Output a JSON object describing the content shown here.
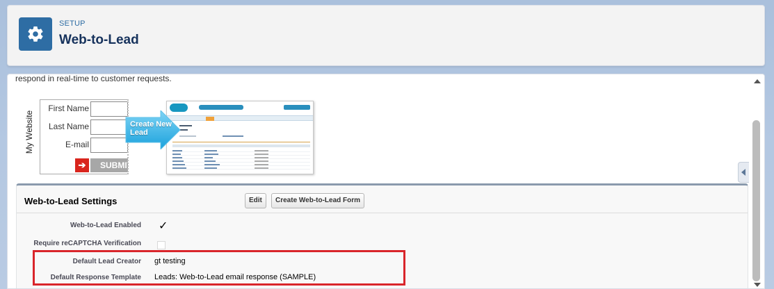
{
  "header": {
    "eyebrow": "SETUP",
    "title": "Web-to-Lead",
    "icon": "gear-icon",
    "icon_bg": "#2e6da4"
  },
  "intro": {
    "text": "respond in real-time to customer requests."
  },
  "illustration": {
    "website_label": "My Website",
    "fields": [
      {
        "label": "First Name"
      },
      {
        "label": "Last Name"
      },
      {
        "label": "E-mail"
      }
    ],
    "submit_label": "SUBMIT",
    "callout": "Create New Lead"
  },
  "settings": {
    "title": "Web-to-Lead Settings",
    "edit_label": "Edit",
    "create_form_label": "Create Web-to-Lead Form",
    "fields": {
      "enabled_label": "Web-to-Lead Enabled",
      "enabled_value": "✓",
      "recaptcha_label": "Require reCAPTCHA Verification",
      "creator_label": "Default Lead Creator",
      "creator_value": "gt testing",
      "template_label": "Default Response Template",
      "template_value": "Leads: Web-to-Lead email response (SAMPLE)"
    }
  },
  "colors": {
    "highlight": "#d9252b",
    "accent": "#2e6da4"
  }
}
